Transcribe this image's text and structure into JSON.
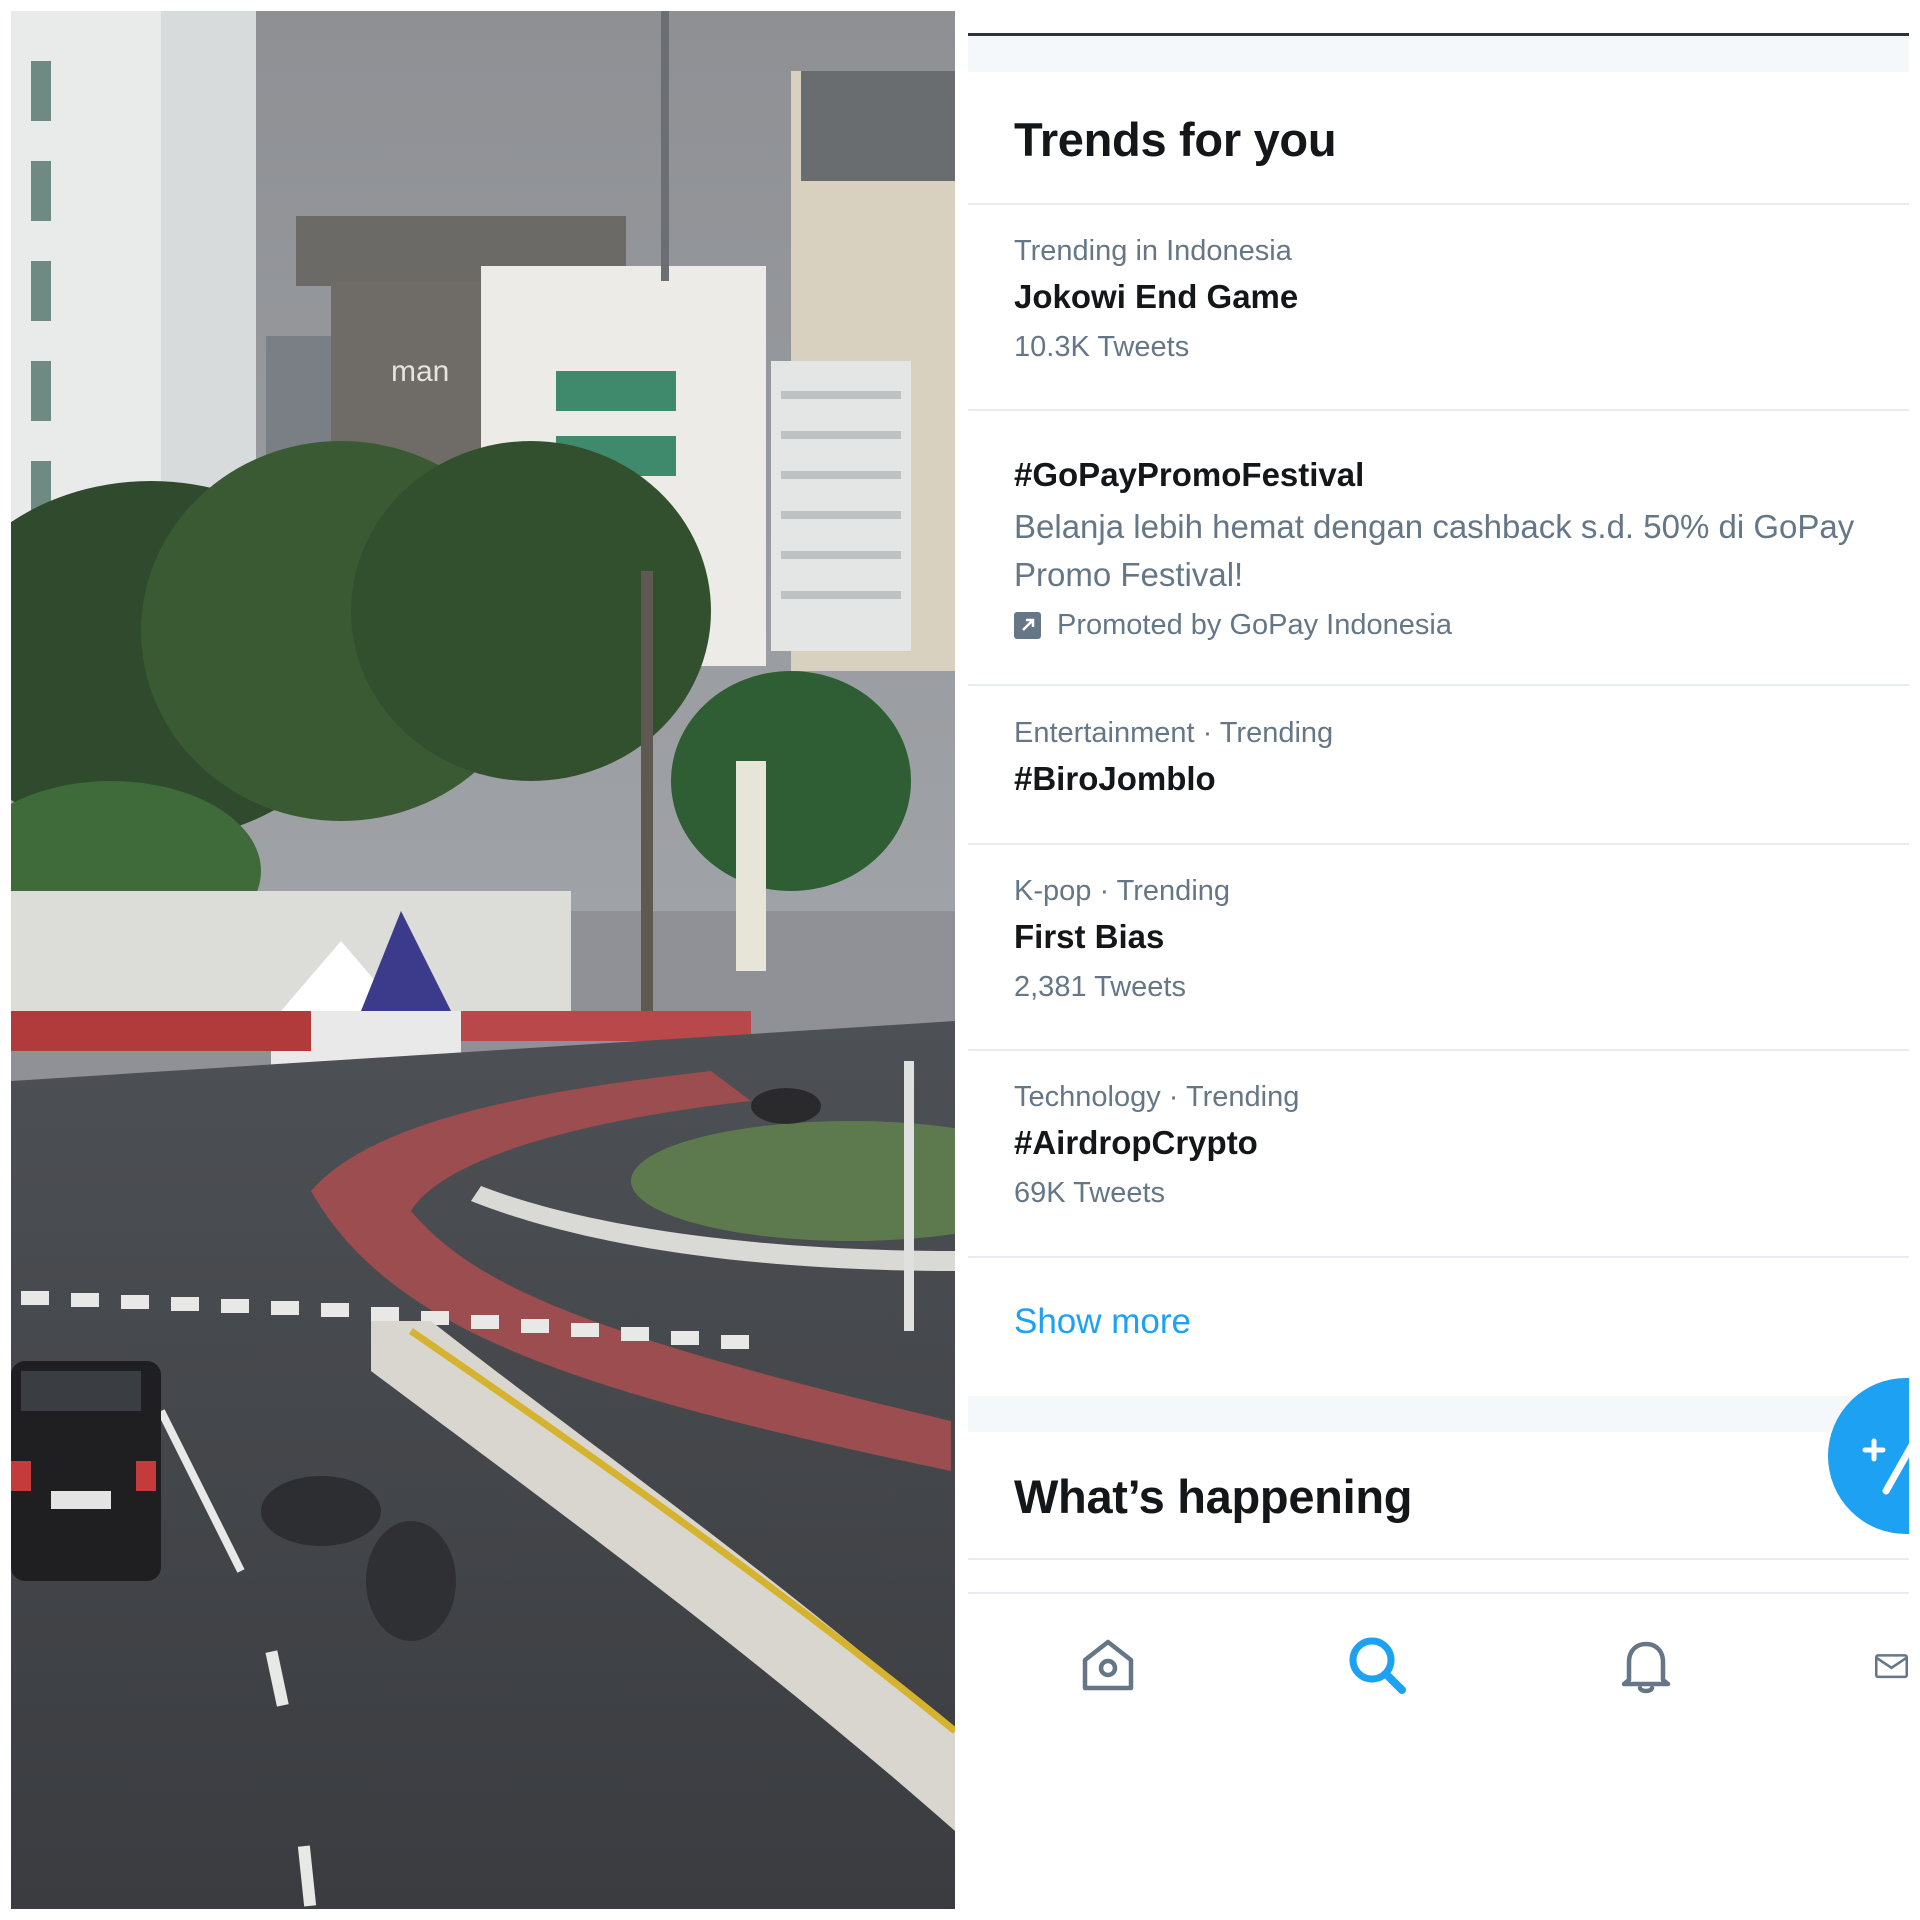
{
  "trends": {
    "title": "Trends for you",
    "items": [
      {
        "meta": "Trending in Indonesia",
        "name": "Jokowi End Game",
        "count": "10.3K Tweets"
      },
      {
        "name": "#GoPayPromoFestival",
        "description": "Belanja lebih hemat dengan cashback s.d. 50% di GoPay Promo Festival!",
        "promoted": "Promoted by GoPay Indonesia"
      },
      {
        "meta": "Entertainment · Trending",
        "name": "#BiroJomblo"
      },
      {
        "meta": "K-pop · Trending",
        "name": "First Bias",
        "count": "2,381 Tweets"
      },
      {
        "meta": "Technology · Trending",
        "name": "#AirdropCrypto",
        "count": "69K Tweets"
      }
    ],
    "show_more": "Show more"
  },
  "whats_happening": {
    "title": "What’s happening"
  },
  "photo": {
    "sign_text": "man"
  },
  "fab": {
    "icon": "compose-plus-icon"
  },
  "nav": {
    "items": [
      {
        "icon": "home-icon",
        "active": false
      },
      {
        "icon": "search-icon",
        "active": true
      },
      {
        "icon": "bell-icon",
        "active": false
      },
      {
        "icon": "mail-icon",
        "active": false
      }
    ]
  },
  "colors": {
    "accent": "#1da1f2",
    "text_primary": "#14171a",
    "text_secondary": "#657786",
    "divider": "#e6ecf0"
  }
}
